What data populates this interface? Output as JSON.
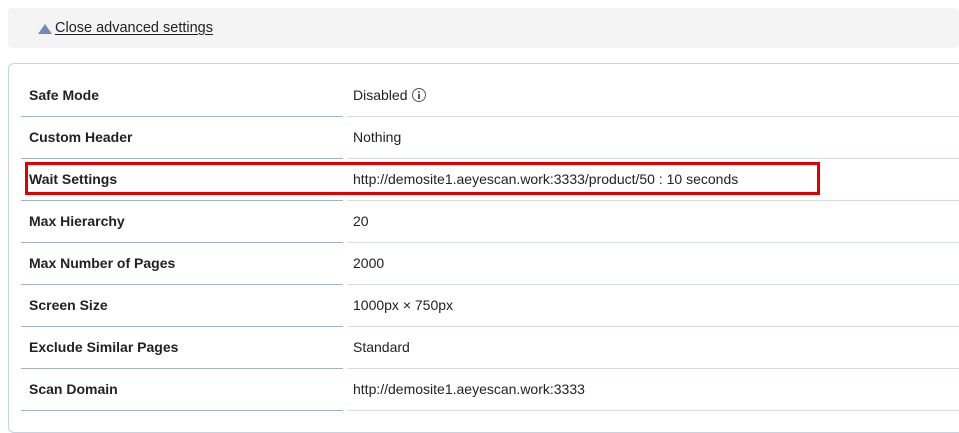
{
  "advanced": {
    "toggle_label": "Close advanced settings"
  },
  "settings": {
    "rows": [
      {
        "label": "Safe Mode",
        "value": "Disabled",
        "has_info": true
      },
      {
        "label": "Custom Header",
        "value": "Nothing"
      },
      {
        "label": "Wait Settings",
        "value": "http://demosite1.aeyescan.work:3333/product/50 : 10 seconds",
        "highlighted": true
      },
      {
        "label": "Max Hierarchy",
        "value": "20"
      },
      {
        "label": "Max Number of Pages",
        "value": "2000"
      },
      {
        "label": "Screen Size",
        "value": "1000px × 750px"
      },
      {
        "label": "Exclude Similar Pages",
        "value": "Standard"
      },
      {
        "label": "Scan Domain",
        "value": "http://demosite1.aeyescan.work:3333"
      }
    ]
  },
  "colors": {
    "highlight": "#e00000",
    "triangle": "#6b8db5"
  },
  "icons": {
    "toggle": "triangle-up-icon",
    "safe_mode_info": "info-icon"
  }
}
